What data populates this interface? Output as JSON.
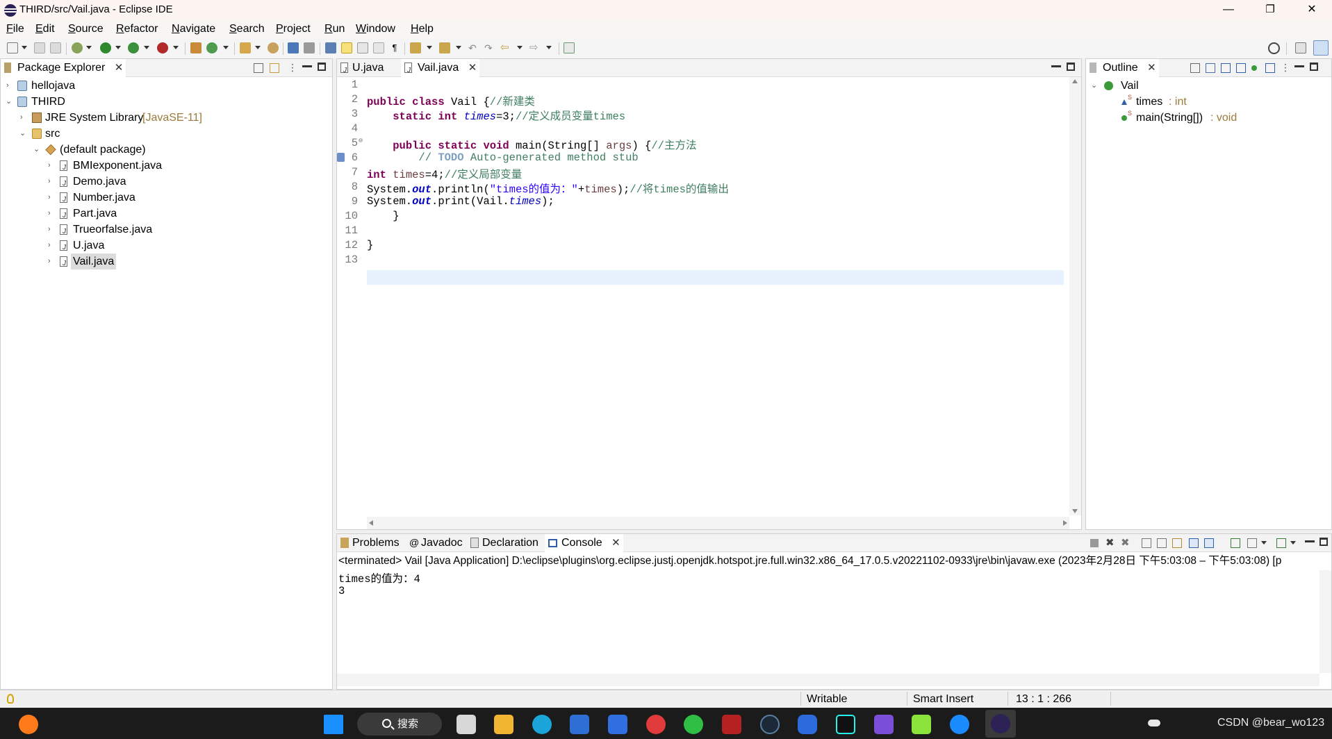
{
  "window": {
    "title": "THIRD/src/Vail.java - Eclipse IDE",
    "minimize_glyph": "—",
    "restore_glyph": "❐",
    "close_glyph": "✕"
  },
  "menu": [
    "File",
    "Edit",
    "Source",
    "Refactor",
    "Navigate",
    "Search",
    "Project",
    "Run",
    "Window",
    "Help"
  ],
  "package_explorer": {
    "tab_label": "Package Explorer",
    "tree": {
      "hellojava": "hellojava",
      "third": "THIRD",
      "jre_name": "JRE System Library",
      "jre_version": "[JavaSE-11]",
      "src": "src",
      "default_package": "(default package)",
      "files": [
        "BMIexponent.java",
        "Demo.java",
        "Number.java",
        "Part.java",
        "Trueorfalse.java",
        "U.java",
        "Vail.java"
      ]
    }
  },
  "editor": {
    "tabs": [
      "U.java",
      "Vail.java"
    ],
    "active_tab": "Vail.java",
    "line_numbers": [
      "1",
      "2",
      "3",
      "4",
      "5",
      "6",
      "7",
      "8",
      "9",
      "10",
      "11",
      "12",
      "13"
    ],
    "code": {
      "l2": {
        "kw1": "public",
        "kw2": "class",
        "name": " Vail {",
        "comment": "//新建类"
      },
      "l3": {
        "kw1": "static",
        "kw2": "int",
        "field": "times",
        "rest": "=3;",
        "comment": "//定义成员变量times"
      },
      "l5": {
        "kw1": "public",
        "kw2": "static",
        "kw3": "void",
        "name": " main(String[] ",
        "param": "args",
        "rest": ") {",
        "comment": "//主方法"
      },
      "l6": {
        "comment_pre": "// ",
        "todo": "TODO",
        "comment": " Auto-generated method stub"
      },
      "l7": {
        "kw": "int",
        "var": "times",
        "rest": "=4;",
        "comment": "//定义局部变量"
      },
      "l8": {
        "pre": "System.",
        "field": "out",
        "mid": ".println(",
        "str": "\"times的值为：\"",
        "plus": "+",
        "var": "times",
        "end": ");",
        "comment": "//将times的值输出"
      },
      "l9": {
        "pre": "System.",
        "field": "out",
        "mid": ".print(Vail.",
        "field2": "times",
        "end": ");"
      },
      "l10": "}",
      "l12": "}"
    }
  },
  "outline": {
    "tab_label": "Outline",
    "class_name": "Vail",
    "members": [
      {
        "name": "times",
        "type": " : int"
      },
      {
        "name": "main(String[])",
        "type": " : void"
      }
    ]
  },
  "bottom_panel": {
    "tabs": [
      "Problems",
      "Javadoc",
      "Declaration",
      "Console"
    ],
    "active_tab": "Console",
    "terminated_line": "<terminated> Vail [Java Application] D:\\eclipse\\plugins\\org.eclipse.justj.openjdk.hotspot.jre.full.win32.x86_64_17.0.5.v20221102-0933\\jre\\bin\\javaw.exe  (2023年2月28日 下午5:03:08 – 下午5:03:08) [p",
    "output": [
      "times的值为：4",
      "3"
    ]
  },
  "status_bar": {
    "writable": "Writable",
    "insert_mode": "Smart Insert",
    "position": "13 : 1 : 266"
  },
  "taskbar": {
    "search_label": "搜索",
    "watermark": "CSDN @bear_wo123"
  }
}
